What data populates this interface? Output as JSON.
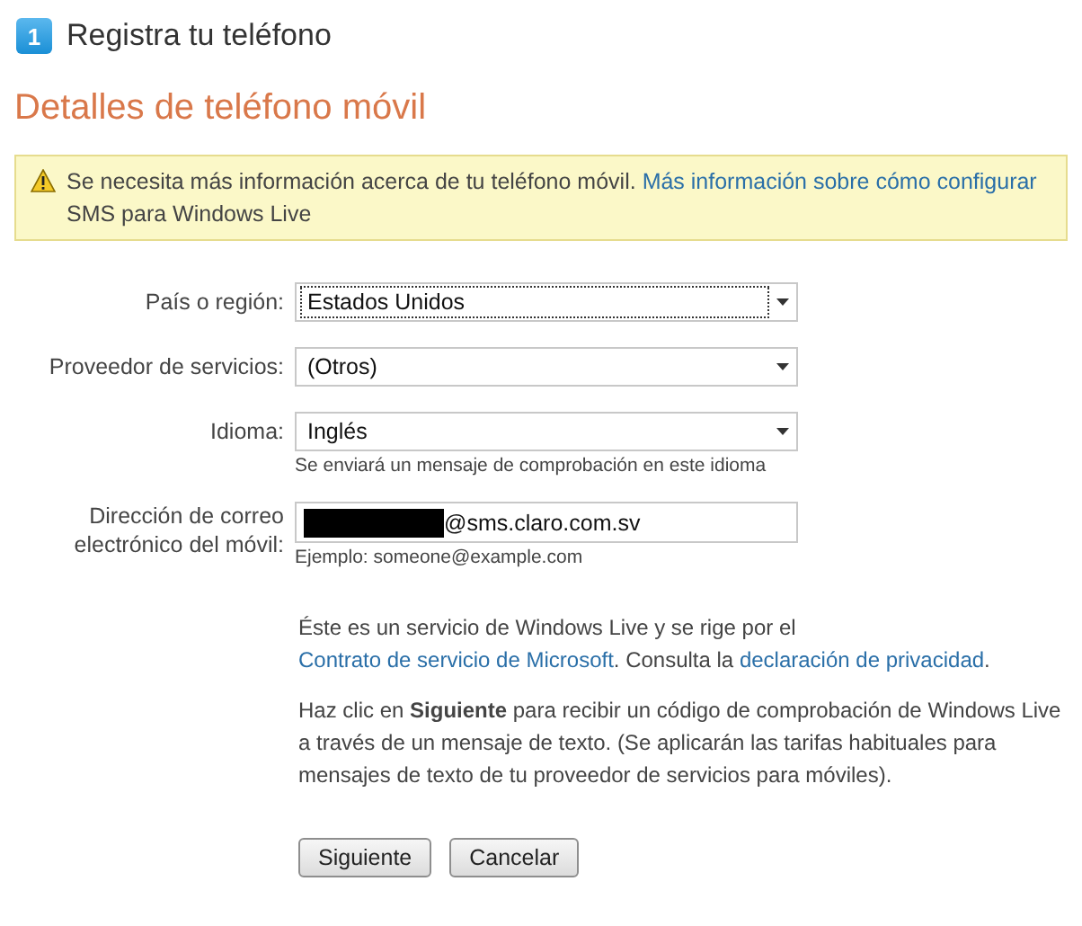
{
  "header": {
    "step": "1",
    "title": "Registra tu teléfono"
  },
  "heading": "Detalles de teléfono móvil",
  "warning": {
    "segments": [
      {
        "text": "Se necesita más información acerca de tu teléfono móvil.",
        "link": false
      },
      {
        "text": "Más información sobre cómo configurar",
        "link": true
      },
      {
        "text": "SMS para Windows Live",
        "link": false
      }
    ]
  },
  "fields": [
    {
      "kind": "select",
      "label": "País o región:",
      "value": "Estados Unidos",
      "focused": true
    },
    {
      "kind": "select",
      "label": "Proveedor de servicios:",
      "value": "(Otros)",
      "focused": false
    },
    {
      "kind": "select",
      "label": "Idioma:",
      "value": "Inglés",
      "focused": false,
      "hint": "Se enviará un mensaje de comprobación en este idioma"
    },
    {
      "kind": "text",
      "label": "Dirección de correo electrónico del móvil:",
      "value": "@sms.claro.com.sv",
      "redacted": true,
      "hint": "Ejemplo: someone@example.com"
    }
  ],
  "paragraphs": [
    [
      {
        "text": "Éste es un servicio de Windows Live y se rige por el",
        "link": false
      },
      {
        "text": "Contrato de servicio de Microsoft",
        "link": true
      },
      {
        "text": ". Consulta la",
        "link": false
      },
      {
        "text": "declaración de privacidad",
        "link": true
      },
      {
        "text": ".",
        "link": false
      }
    ],
    [
      {
        "text": "Haz clic en **Siguiente** para recibir un código de comprobación de Windows Live a través de un mensaje de texto. (Se aplicarán las tarifas habituales para mensajes de texto de tu proveedor de servicios para móviles).",
        "link": false
      }
    ]
  ],
  "buttons": [
    "Siguiente",
    "Cancelar"
  ]
}
